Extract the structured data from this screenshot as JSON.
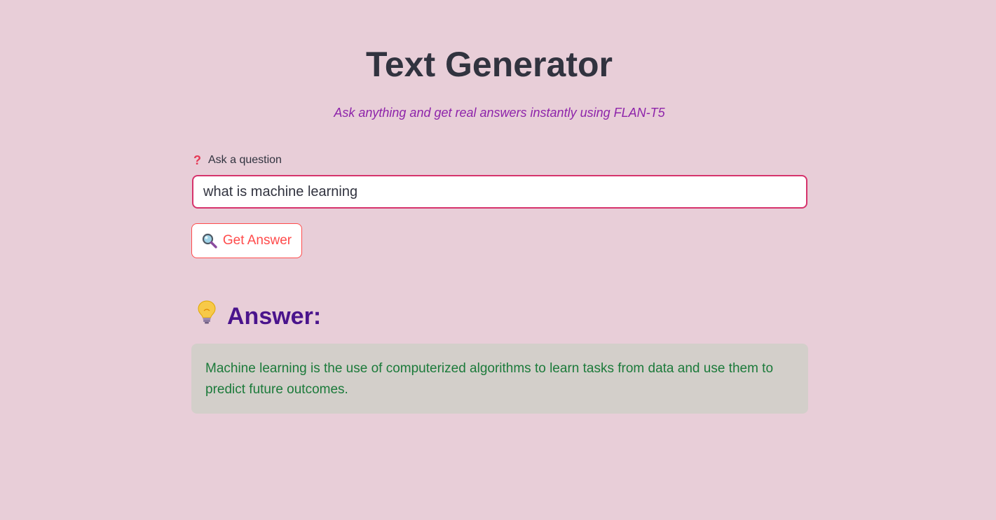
{
  "header": {
    "title": "Text Generator",
    "subtitle": "Ask anything and get real answers instantly using FLAN-T5"
  },
  "question": {
    "icon": "question-mark-icon",
    "label": "Ask a question",
    "value": "what is machine learning"
  },
  "submit_button": {
    "icon": "magnifier-icon",
    "label": "Get Answer"
  },
  "answer": {
    "icon": "lightbulb-icon",
    "heading": "Answer:",
    "text": "Machine learning is the use of computerized algorithms to learn tasks from data and use them to predict future outcomes."
  },
  "colors": {
    "background": "#e8ced8",
    "title": "#31333f",
    "subtitle": "#8e24aa",
    "input_border": "#d6336c",
    "button_accent": "#ff4b4b",
    "answer_heading": "#4a148c",
    "answer_box": "#d3cfca",
    "answer_text": "#1b7a3a"
  }
}
